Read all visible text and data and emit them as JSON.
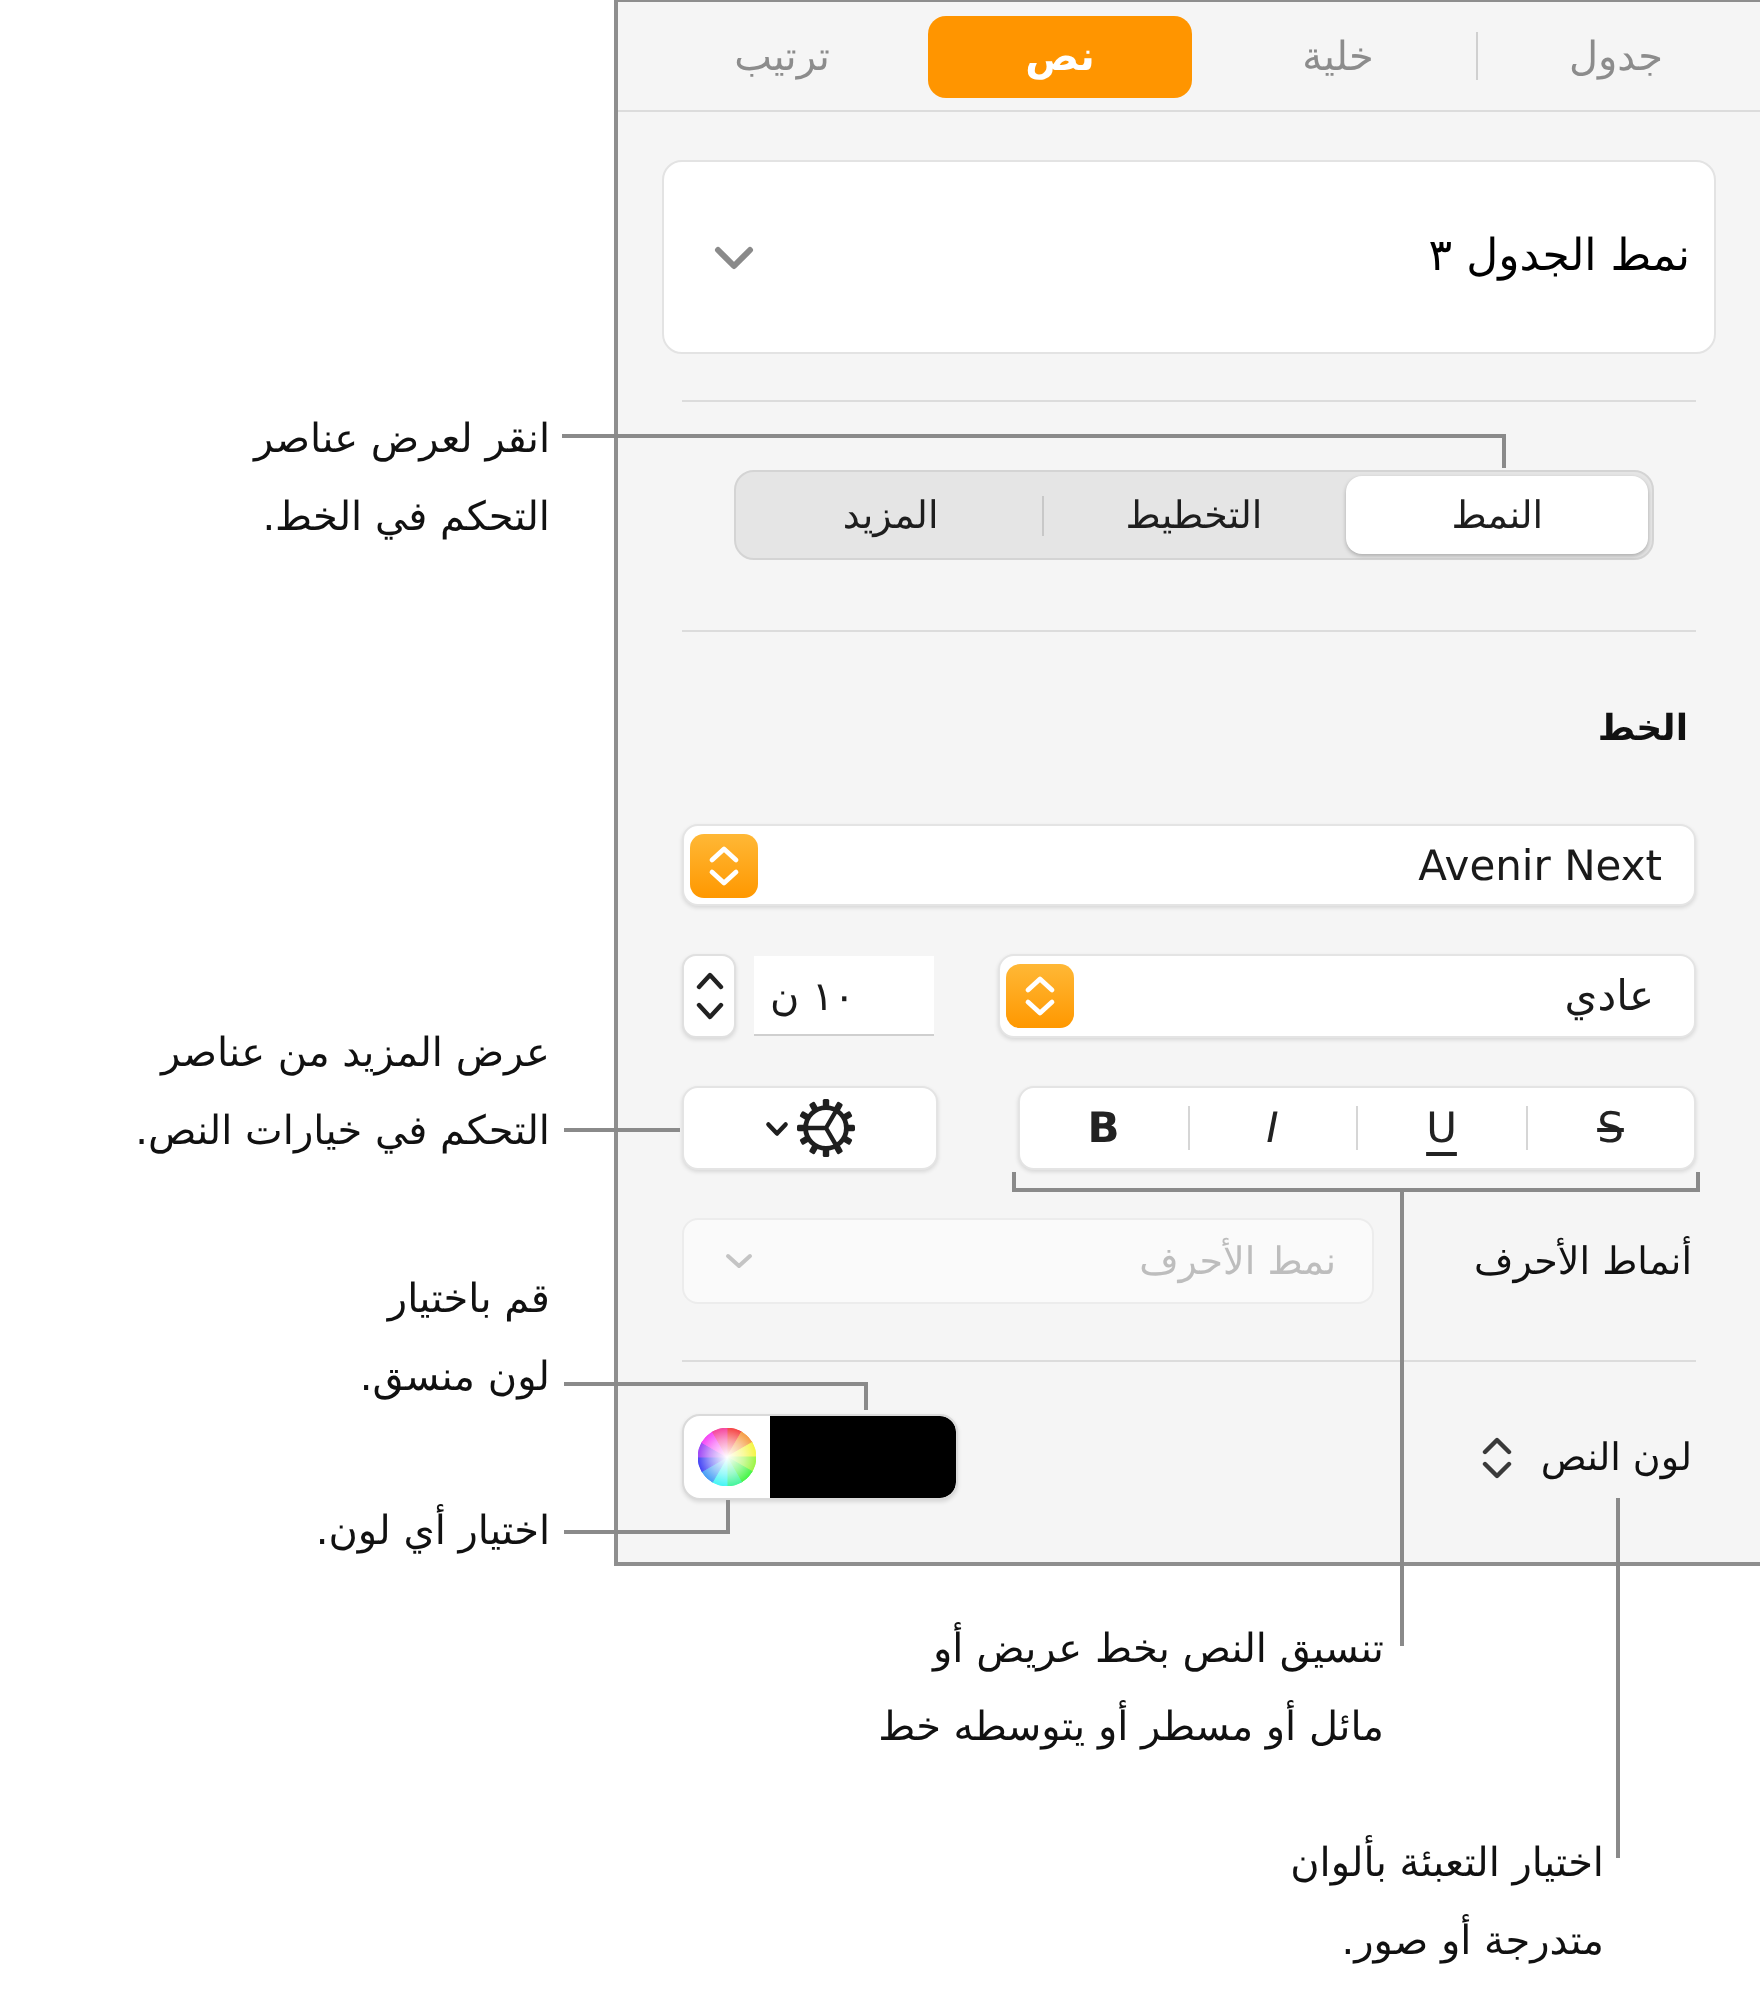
{
  "inspector": {
    "tabs": [
      {
        "label": "جدول",
        "selected": false
      },
      {
        "label": "خلية",
        "selected": false
      },
      {
        "label": "نص",
        "selected": true
      },
      {
        "label": "ترتيب",
        "selected": false
      }
    ],
    "table_style": "نمط الجدول ٣",
    "segments": [
      {
        "label": "النمط",
        "selected": true
      },
      {
        "label": "التخطيط",
        "selected": false
      },
      {
        "label": "المزيد",
        "selected": false
      }
    ],
    "font": {
      "heading": "الخط",
      "family": "Avenir Next",
      "typeface": "عادي",
      "size": "١٠ ن",
      "styles": [
        {
          "label": "S",
          "kind": "strikethrough"
        },
        {
          "label": "U",
          "kind": "underline"
        },
        {
          "label": "I",
          "kind": "italic"
        },
        {
          "label": "B",
          "kind": "bold"
        }
      ]
    },
    "character_styles": {
      "label": "أنماط الأحرف",
      "value": "نمط الأحرف",
      "disabled": true
    },
    "text_color": {
      "label": "لون النص",
      "color": "#000000"
    }
  },
  "callouts": [
    "انقر لعرض عناصر\nالتحكم في الخط.",
    "عرض المزيد من عناصر\nالتحكم في خيارات النص.",
    "قم باختيار\nلون منسق.",
    "اختيار أي لون.",
    "تنسيق النص بخط عريض أو\nمائل أو مسطر أو يتوسطه خط",
    "اختيار التعبئة بألوان\nمتدرجة أو صور."
  ]
}
